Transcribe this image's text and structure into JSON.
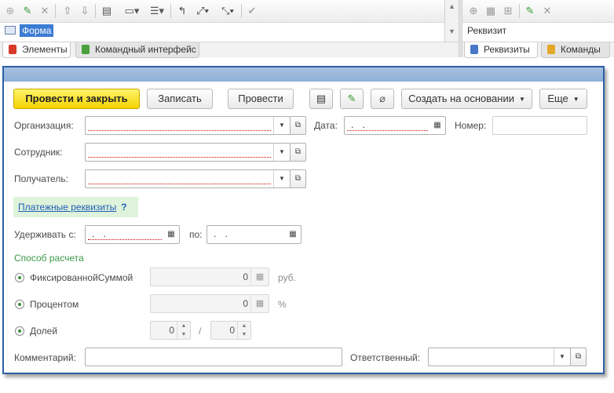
{
  "designer": {
    "tree_item": "Форма",
    "props_title": "Реквизит",
    "left_tabs": [
      "Элементы",
      "Командный интерфейс"
    ],
    "right_tabs": [
      "Реквизиты",
      "Команды"
    ]
  },
  "form": {
    "buttons": {
      "post_close": "Провести и закрыть",
      "save": "Записать",
      "post": "Провести",
      "based_on": "Создать на основании",
      "more": "Еще"
    },
    "labels": {
      "organization": "Организация:",
      "date": "Дата:",
      "number": "Номер:",
      "employee": "Сотрудник:",
      "recipient": "Получатель:",
      "payment_details": "Платежные реквизиты",
      "help": "?",
      "withhold_from": "Удерживать с:",
      "to": "по:",
      "calc_method": "Способ расчета",
      "fixed": "ФиксированнойСуммой",
      "percent": "Процентом",
      "share": "Долей",
      "comment": "Комментарий:",
      "responsible": "Ответственный:",
      "rub": "руб.",
      "percent_sign": "%",
      "slash": "/"
    },
    "values": {
      "date": ". .",
      "withhold_from": ". .",
      "to": ". .",
      "fixed_amount": "0",
      "percent_amount": "0",
      "share_num": "0",
      "share_den": "0"
    }
  }
}
